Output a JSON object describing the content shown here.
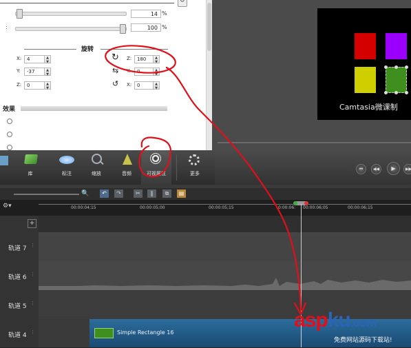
{
  "properties": {
    "opacity_value": "14",
    "opacity_unit": "%",
    "scale_value": "100",
    "scale_unit": "%",
    "position_title": "",
    "rotation_title": "旋转",
    "position": [
      {
        "label": "X:",
        "value": "4"
      },
      {
        "label": "Y:",
        "value": "-37"
      },
      {
        "label": "Z:",
        "value": "0"
      }
    ],
    "rotation": [
      {
        "label": "Z:",
        "value": "180"
      },
      {
        "label": "Y:",
        "value": "0"
      },
      {
        "label": "X:",
        "value": "0"
      }
    ],
    "effects_title": "效果",
    "options": [
      "",
      "",
      ""
    ]
  },
  "preview": {
    "caption": "Camtasia微课制",
    "squares": [
      "#d40000",
      "#9b00ff",
      "#cfcf00",
      "#3f8f1f"
    ]
  },
  "toolbar": {
    "items": [
      {
        "label": "库",
        "icon": "library-icon"
      },
      {
        "label": "标注",
        "icon": "callout-icon"
      },
      {
        "label": "缩放",
        "icon": "zoom-icon"
      },
      {
        "label": "音频",
        "icon": "audio-icon"
      },
      {
        "label": "可视属性",
        "icon": "visual-properties-icon"
      },
      {
        "label": "更多",
        "icon": "more-icon"
      }
    ]
  },
  "timeline": {
    "ruler_ticks": [
      "00:00:04;15",
      "00:00:05;00",
      "00:00:05;15",
      "0:00:06:",
      "00:00:06;05",
      "00:00:06;15"
    ],
    "tracks": [
      {
        "name": "轨道 7"
      },
      {
        "name": "轨道 6"
      },
      {
        "name": "轨道 5"
      },
      {
        "name": "轨道 4"
      }
    ],
    "clip_label": "Simple Rectangle 16"
  },
  "watermark": {
    "brand_a": "asp",
    "brand_b": "ku",
    "brand_c": ".com",
    "tagline": "免费网站源码下载站!"
  },
  "colors": {
    "annotation": "#e0101a",
    "clip_blue": "#1f5a86",
    "watermark_red": "#e0101a",
    "watermark_blue": "#2b63b5"
  }
}
